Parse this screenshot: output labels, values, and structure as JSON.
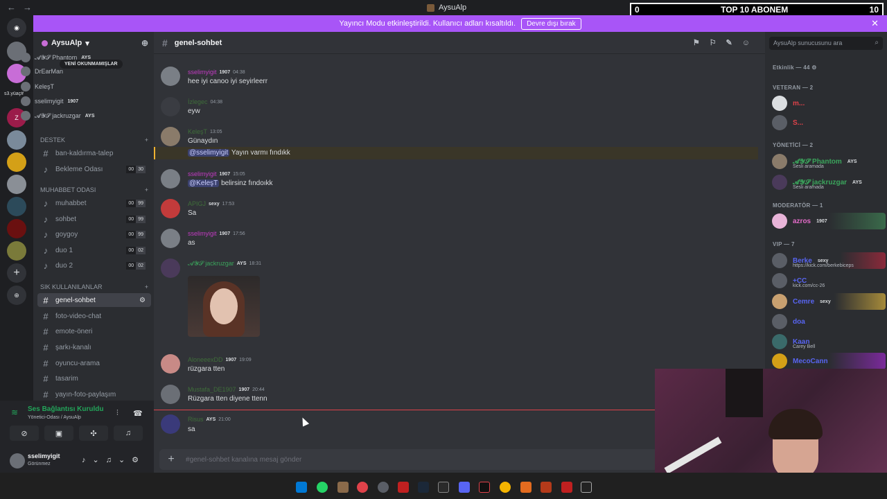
{
  "titlebar": {
    "title": "AysuAlp"
  },
  "overlay": {
    "left": "0",
    "center": "TOP 10 ABONEM",
    "right": "10"
  },
  "banner": {
    "text": "Yayıncı Modu etkinleştirildi. Kullanıcı adları kısaltıldı.",
    "button": "Devre dışı bırak"
  },
  "rail": {
    "label": "s3.yüaç#"
  },
  "server": {
    "name": "AysuAlp"
  },
  "sidebar": {
    "unread_pill": "YENİ OKUNMAMIŞLAR",
    "voice_users": [
      {
        "name": "𝓐𝓨𝓢 Phantom",
        "tag": "AYS"
      },
      {
        "name": "DrEarMan",
        "tag": ""
      },
      {
        "name": "KeleşT",
        "tag": ""
      },
      {
        "name": "sselimyigit",
        "tag": "1907"
      },
      {
        "name": "𝓐𝓨𝓢 jackruzgar",
        "tag": "AYS"
      }
    ],
    "categories": {
      "destek": "DESTEK",
      "muhabbet": "MUHABBET ODASI",
      "sik": "SIK KULLANILANLAR"
    },
    "channels": {
      "ban": "ban-kaldırma-talep",
      "bekleme": {
        "name": "Bekleme Odası",
        "a": "00",
        "b": "30"
      },
      "muhabbet": {
        "name": "muhabbet",
        "a": "00",
        "b": "99"
      },
      "sohbet": {
        "name": "sohbet",
        "a": "00",
        "b": "99"
      },
      "goygoy": {
        "name": "goygoy",
        "a": "00",
        "b": "99"
      },
      "duo1": {
        "name": "duo 1",
        "a": "00",
        "b": "02"
      },
      "duo2": {
        "name": "duo 2",
        "a": "00",
        "b": "02"
      },
      "genel": "genel-sohbet",
      "foto": "foto-video-chat",
      "emote": "emote-öneri",
      "sarki": "şarkı-kanalı",
      "oyuncu": "oyuncu-arama",
      "tasarim": "tasarim",
      "yayin": "yayın-foto-paylaşım"
    }
  },
  "voice_panel": {
    "title": "Ses Bağlantısı Kuruldu",
    "sub": "Yönetici-Odası / AysuAlp"
  },
  "me": {
    "name": "sselimyigit",
    "status": "Görünmez"
  },
  "chat": {
    "channel": "genel-sohbet",
    "messages": [
      {
        "author": "sselimyigit",
        "color": "#c23bc2",
        "badge": "1907",
        "time": "04:38",
        "text": "hee iyi canoo iyi seyirleerr"
      },
      {
        "author": "İzlegec",
        "color": "#3f6e3a",
        "badge": "",
        "time": "04:38",
        "text": "eyw"
      },
      {
        "author": "KeleşT",
        "color": "#3f6e3a",
        "badge": "",
        "time": "13:05",
        "text": "Günaydın"
      },
      {
        "author": "",
        "color": "",
        "badge": "",
        "time": "",
        "mention": "@sselimyigit",
        "text": "Yayın varmı fındıkk"
      },
      {
        "author": "sselimyigit",
        "color": "#c23bc2",
        "badge": "1907",
        "time": "15:05",
        "mention": "@KeleşT",
        "text": "belirsinz fındoıkk"
      },
      {
        "author": "APIGJ",
        "color": "#3f6e3a",
        "badge": "sexy",
        "time": "17:53",
        "text": "Sa"
      },
      {
        "author": "sselimyigit",
        "color": "#c23bc2",
        "badge": "1907",
        "time": "17:56",
        "text": "as"
      },
      {
        "author": "𝓐𝓨𝓢 jackruzgar",
        "color": "#3ba55c",
        "badge": "AYS",
        "time": "18:31",
        "text": ""
      },
      {
        "author": "AloneeexDD",
        "color": "#3f6e3a",
        "badge": "1907",
        "time": "19:09",
        "text": "rüzgara tten"
      },
      {
        "author": "Mustafa_DE1907",
        "color": "#3f6e3a",
        "badge": "1907",
        "time": "20:44",
        "text": "Rüzgara tten diyene ttenn"
      },
      {
        "author": "Risus",
        "color": "#3f6e3a",
        "badge": "AYS",
        "time": "21:00",
        "text": "sa"
      }
    ],
    "composer_placeholder": "genel-sohbet kanalına mesaj gönder"
  },
  "members": {
    "search_placeholder": "AysuAlp sunucusunu ara",
    "activity": "Etkinlik — 44",
    "groups": {
      "veteran": "VETERAN — 2",
      "yonetici": "YÖNETİCİ — 2",
      "moderator": "MODERATÖR — 1",
      "vip": "VIP — 7"
    },
    "list": [
      {
        "name": "m...",
        "color": "#e0424a",
        "sub": "",
        "badge": ""
      },
      {
        "name": "S...",
        "color": "#e0424a",
        "sub": "",
        "badge": ""
      },
      {
        "name": "𝓐𝓨𝓢 Phantom",
        "color": "#3ba55c",
        "sub": "Sesli aramada",
        "badge": "AYS"
      },
      {
        "name": "𝓐𝓨𝓢 jackruzgar",
        "color": "#3ba55c",
        "sub": "Sesli aramada",
        "badge": "AYS"
      },
      {
        "name": "azros",
        "color": "#e36bc8",
        "sub": "",
        "badge": "1907"
      },
      {
        "name": "Berke",
        "color": "#5865f2",
        "sub": "https://kick.com/berkebiceps",
        "badge": "sexy"
      },
      {
        "name": "+CC",
        "color": "#5865f2",
        "sub": "kick.com/cc-26",
        "badge": ""
      },
      {
        "name": "Cemre",
        "color": "#5865f2",
        "sub": "",
        "badge": "sexy"
      },
      {
        "name": "doa",
        "color": "#5865f2",
        "sub": "",
        "badge": ""
      },
      {
        "name": "Kaan",
        "color": "#5865f2",
        "sub": "Carey Bell",
        "badge": ""
      },
      {
        "name": "MecoCann",
        "color": "#5865f2",
        "sub": "",
        "badge": ""
      }
    ]
  },
  "colors": {
    "accent": "#a855f7",
    "online": "#23a55a",
    "danger": "#e0424a"
  }
}
